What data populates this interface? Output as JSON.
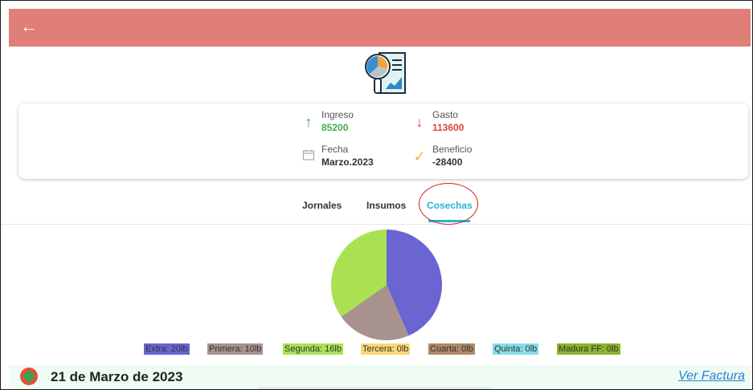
{
  "appbar": {
    "color": "#e07e78",
    "back_icon": "arrow-left-icon"
  },
  "hero_icon": "report-analytics-icon",
  "summary": {
    "ingreso": {
      "label": "Ingreso",
      "value": "85200",
      "color": "#3fae49",
      "icon": "arrow-up-icon"
    },
    "gasto": {
      "label": "Gasto",
      "value": "113600",
      "color": "#d9453a",
      "icon": "arrow-down-icon"
    },
    "fecha": {
      "label": "Fecha",
      "value": "Marzo.2023",
      "icon": "calendar-icon"
    },
    "beneficio": {
      "label": "Beneficio",
      "value": "-28400",
      "icon": "checkmark-icon"
    }
  },
  "tabs": [
    {
      "label": "Jornales",
      "active": false
    },
    {
      "label": "Insumos",
      "active": false
    },
    {
      "label": "Cosechas",
      "active": true
    }
  ],
  "chart_data": {
    "type": "pie",
    "slices": [
      {
        "label": "Extra",
        "value": 20,
        "color": "#6a65d1"
      },
      {
        "label": "Primera",
        "value": 10,
        "color": "#a8928e"
      },
      {
        "label": "Segunda",
        "value": 16,
        "color": "#a9e153"
      },
      {
        "label": "Tercera",
        "value": 0,
        "color": "#f9d876"
      },
      {
        "label": "Cuarta",
        "value": 0,
        "color": "#ae8a67"
      },
      {
        "label": "Quinta",
        "value": 0,
        "color": "#86dde8"
      },
      {
        "label": "Madura FF",
        "value": 0,
        "color": "#8bb42d"
      }
    ]
  },
  "legend": [
    {
      "text": "Extra: 20lb",
      "color": "#6a65d1"
    },
    {
      "text": "Primera: 10lb",
      "color": "#a8928e"
    },
    {
      "text": "Segunda: 16lb",
      "color": "#a9e153"
    },
    {
      "text": "Tercera: 0lb",
      "color": "#f9d876"
    },
    {
      "text": "Cuarta: 0lb",
      "color": "#ae8a67"
    },
    {
      "text": "Quinta: 0lb",
      "color": "#86dde8"
    },
    {
      "text": "Madura FF: 0lb",
      "color": "#8bb42d"
    }
  ],
  "entry": {
    "date": "21 de Marzo de 2023",
    "link": "Ver Factura"
  }
}
